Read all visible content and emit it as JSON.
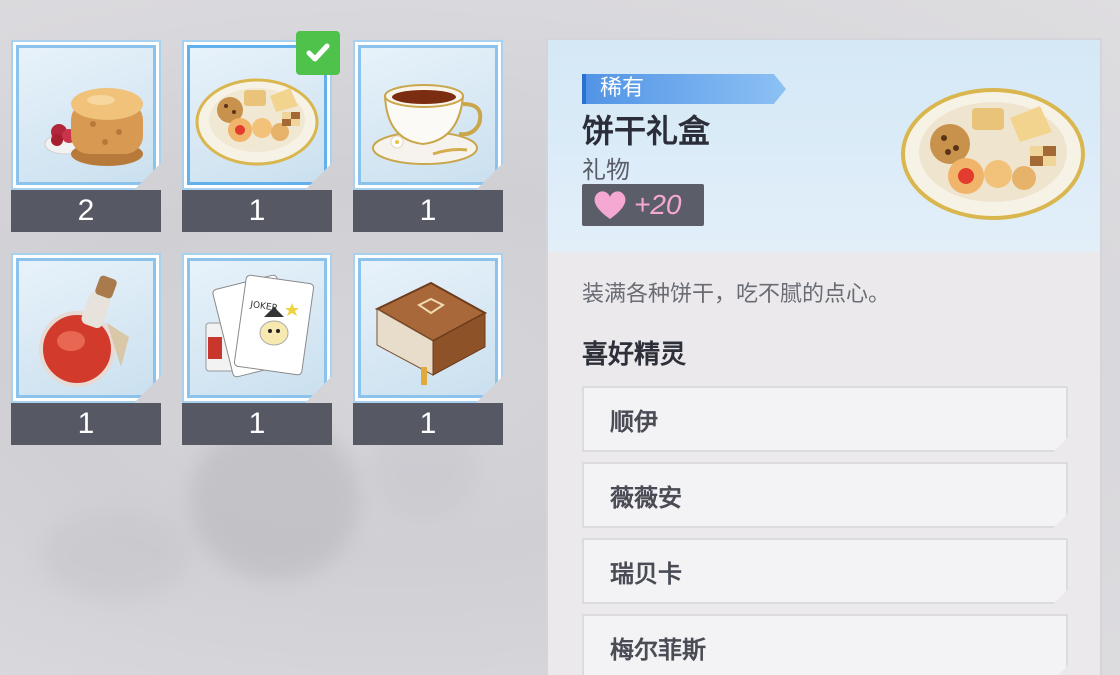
{
  "inventory": [
    {
      "name": "scone-item",
      "count": "2"
    },
    {
      "name": "cookie-gift-box-item",
      "count": "1",
      "selected": true
    },
    {
      "name": "teacup-item",
      "count": "1"
    },
    {
      "name": "potion-bottle-item",
      "count": "1"
    },
    {
      "name": "joker-cards-item",
      "count": "1"
    },
    {
      "name": "leather-book-item",
      "count": "1"
    }
  ],
  "detail": {
    "rarity": "稀有",
    "name": "饼干礼盒",
    "type": "礼物",
    "affection": "+20",
    "description": "装满各种饼干，吃不腻的点心。",
    "liked_title": "喜好精灵",
    "liked_sprites": [
      "顺伊",
      "薇薇安",
      "瑞贝卡",
      "梅尔菲斯"
    ]
  },
  "colors": {
    "selected_check": "#4fc24b",
    "rarity_blue": "#5294e6",
    "affection_pink": "#f5a8d2",
    "count_bar": "#565964"
  }
}
